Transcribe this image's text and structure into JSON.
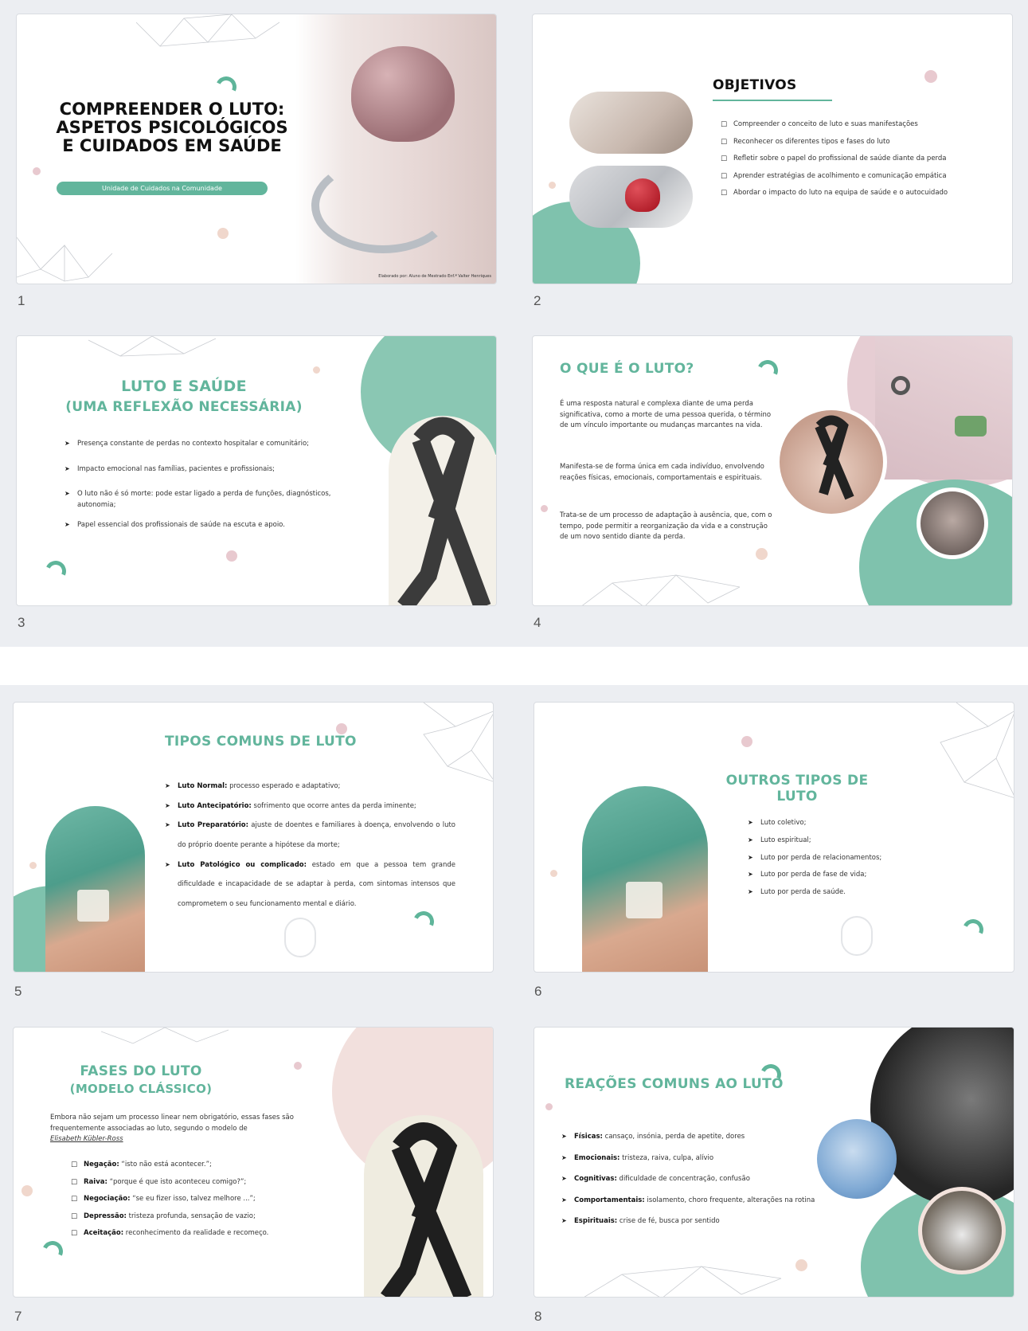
{
  "slides": {
    "s1": {
      "num": "1",
      "title": "COMPREENDER O LUTO: ASPETOS PSICOLÓGICOS E CUIDADOS EM SAÚDE",
      "subtitle": "Unidade de Cuidados na Comunidade",
      "credit": "Elaborado por: Aluno de Mestrado Enf.ª Valter Henriques"
    },
    "s2": {
      "num": "2",
      "title": "OBJETIVOS",
      "items": [
        "Compreender o conceito de luto e suas manifestações",
        "Reconhecer os diferentes tipos e fases do luto",
        "Refletir sobre o papel do profissional de saúde diante da perda",
        "Aprender estratégias de acolhimento e comunicação empática",
        "Abordar o impacto do luto na equipa de saúde e o autocuidado"
      ]
    },
    "s3": {
      "num": "3",
      "title1": "LUTO E SAÚDE",
      "title2": "(UMA REFLEXÃO NECESSÁRIA)",
      "items": [
        "Presença constante de perdas no contexto hospitalar e comunitário;",
        "Impacto emocional nas famílias, pacientes e profissionais;",
        "O luto não é só morte: pode estar ligado a perda de funções, diagnósticos, autonomia;",
        "Papel essencial dos profissionais de saúde na escuta e apoio."
      ]
    },
    "s4": {
      "num": "4",
      "title": "O QUE É O LUTO?",
      "p1": "É uma resposta natural e complexa diante de uma perda significativa, como a morte de uma pessoa querida, o término de um vínculo importante ou mudanças marcantes na vida.",
      "p2": "Manifesta-se de forma única em cada indivíduo, envolvendo reações físicas, emocionais, comportamentais e espirituais.",
      "p3": "Trata-se de um processo de adaptação à ausência, que, com o tempo, pode permitir a reorganização da vida e a construção de um novo sentido diante da perda."
    },
    "s5": {
      "num": "5",
      "title": "TIPOS COMUNS DE LUTO",
      "items": [
        {
          "k": "Luto Normal:",
          "v": " processo esperado e adaptativo;"
        },
        {
          "k": "Luto Antecipatório:",
          "v": " sofrimento que ocorre antes da perda iminente;"
        },
        {
          "k": "Luto Preparatório:",
          "v": " ajuste de doentes e familiares à doença, envolvendo o luto do próprio doente perante a hipótese da morte;"
        },
        {
          "k": "Luto Patológico ou complicado:",
          "v": " estado em que a pessoa tem grande dificuldade e incapacidade de se adaptar à perda, com sintomas intensos que comprometem o seu funcionamento mental e diário."
        }
      ]
    },
    "s6": {
      "num": "6",
      "title": "OUTROS TIPOS DE LUTO",
      "items": [
        "Luto coletivo;",
        "Luto espiritual;",
        "Luto por perda de relacionamentos;",
        "Luto por perda de fase de vida;",
        "Luto por perda de saúde."
      ]
    },
    "s7": {
      "num": "7",
      "title1": "FASES DO LUTO",
      "title2": "(MODELO CLÁSSICO)",
      "intro": "Embora não sejam um processo linear nem obrigatório, essas fases são frequentemente associadas ao luto, segundo o modelo de",
      "author": "Elisabeth Kübler-Ross",
      "items": [
        {
          "k": "Negação:",
          "v": " “isto não está acontecer.”;"
        },
        {
          "k": "Raiva:",
          "v": " “porque é que isto aconteceu comigo?”;"
        },
        {
          "k": "Negociação:",
          "v": " “se eu fizer isso, talvez melhore ...”;"
        },
        {
          "k": "Depressão:",
          "v": " tristeza profunda, sensação de vazio;"
        },
        {
          "k": "Aceitação:",
          "v": " reconhecimento da realidade e recomeço."
        }
      ]
    },
    "s8": {
      "num": "8",
      "title": "REAÇÕES COMUNS AO LUTO",
      "items": [
        {
          "k": "Físicas:",
          "v": " cansaço, insónia, perda de apetite, dores"
        },
        {
          "k": "Emocionais:",
          "v": " tristeza, raiva, culpa, alívio"
        },
        {
          "k": "Cognitivas:",
          "v": " dificuldade de concentração, confusão"
        },
        {
          "k": "Comportamentais:",
          "v": " isolamento, choro frequente, alterações na rotina"
        },
        {
          "k": "Espirituais:",
          "v": " crise de fé, busca por sentido"
        }
      ]
    }
  },
  "colors": {
    "teal": "#62b59c",
    "pink": "#e8c9cf",
    "panel": "#eceef2"
  }
}
